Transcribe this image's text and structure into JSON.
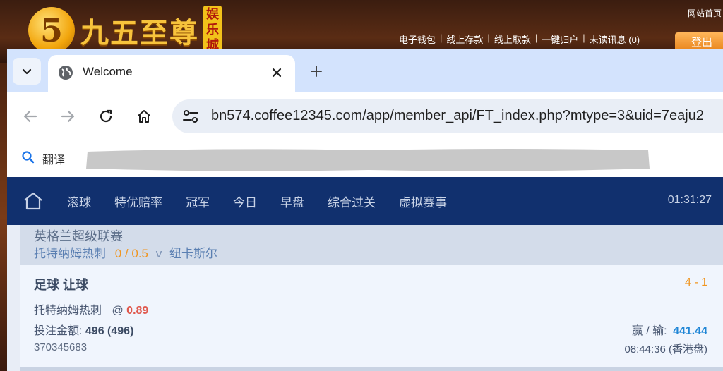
{
  "site": {
    "logo_badge": "5",
    "logo_text": "九五至尊",
    "logo_tag": "娱乐城",
    "home_link": "网站首页",
    "nav": [
      "电子钱包",
      "线上存款",
      "线上取款",
      "一键归户",
      "未读讯息 (0)"
    ],
    "logout": "登出"
  },
  "browser": {
    "tab_title": "Welcome",
    "url": "bn574.coffee12345.com/app/member_api/FT_index.php?mtype=3&uid=7eaju2",
    "bookmark_label": "翻译",
    "icons": [
      "chevron-down-icon",
      "globe-icon",
      "close-icon",
      "plus-icon",
      "back-arrow-icon",
      "forward-arrow-icon",
      "reload-icon",
      "home-icon",
      "site-settings-icon",
      "search-icon"
    ]
  },
  "app": {
    "nav_items": [
      "滚球",
      "特优赔率",
      "冠军",
      "今日",
      "早盘",
      "综合过关",
      "虚拟赛事"
    ],
    "clock": "01:31:27"
  },
  "match": {
    "league": "英格兰超级联赛",
    "home_team": "托特纳姆热刺",
    "handicap": "0 / 0.5",
    "vs": "v",
    "away_team": "纽卡斯尔"
  },
  "bet": {
    "type": "足球 让球",
    "score": "4 - 1",
    "pick": "托特纳姆热刺",
    "at": "@",
    "odds": "0.89",
    "stake_label": "投注金额:",
    "stake_value": "496 (496)",
    "winloss_label": "赢 / 输:",
    "winloss_value": "441.44",
    "ticket_id": "370345683",
    "time": "08:44:36 (香港盘)"
  }
}
